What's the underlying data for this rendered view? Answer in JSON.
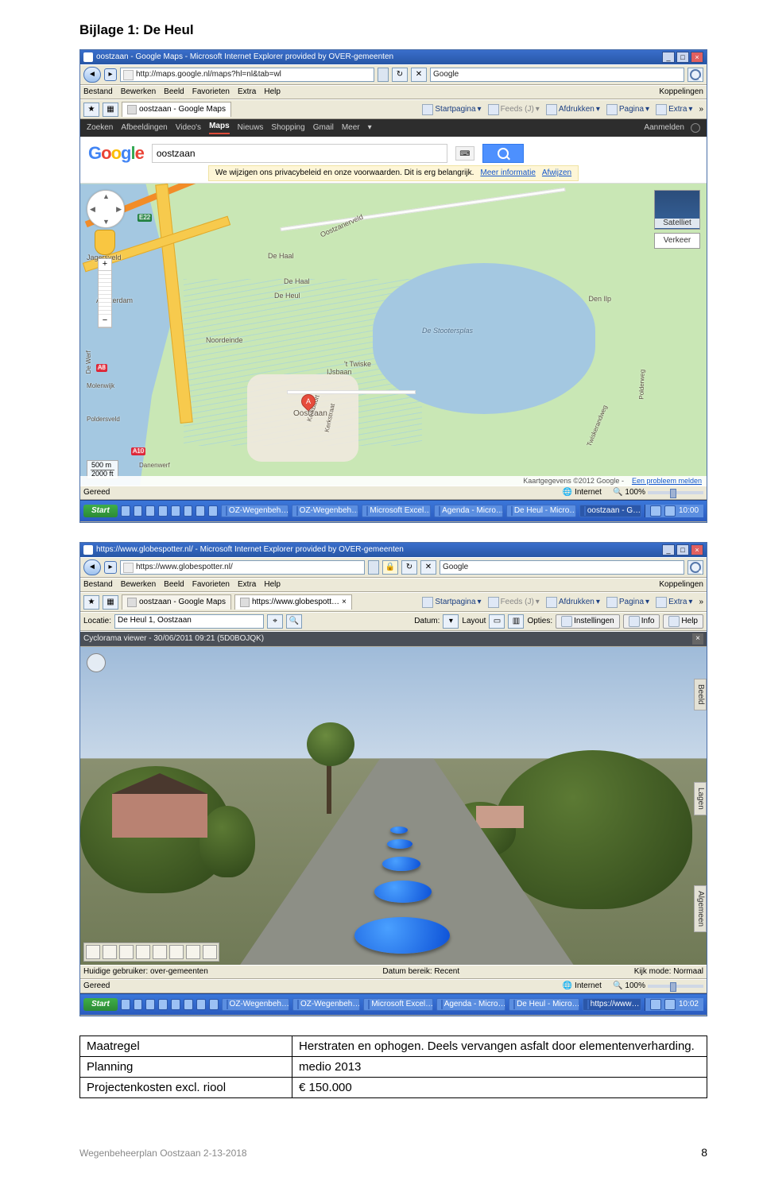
{
  "doc": {
    "title": "Bijlage 1: De Heul",
    "footer_left": "Wegenbeheerplan Oostzaan 2-13-2018",
    "page_number": "8"
  },
  "ie1": {
    "title": "oostzaan - Google Maps - Microsoft Internet Explorer provided by OVER-gemeenten",
    "url": "http://maps.google.nl/maps?hl=nl&tab=wl",
    "search_placeholder": "Google",
    "menus": [
      "Bestand",
      "Bewerken",
      "Beeld",
      "Favorieten",
      "Extra",
      "Help"
    ],
    "menu_right": "Koppelingen",
    "tab": "oostzaan - Google Maps",
    "toolbar_items": [
      "Startpagina",
      "Feeds (J)",
      "Afdrukken",
      "Pagina",
      "Extra"
    ],
    "toolbar_rss": "Feeds (J)",
    "status_left": "Gereed",
    "status_zone": "Internet",
    "status_zoom": "100%"
  },
  "gmaps": {
    "nav": [
      "Zoeken",
      "Afbeeldingen",
      "Video's",
      "Maps",
      "Nieuws",
      "Shopping",
      "Gmail",
      "Meer"
    ],
    "nav_active_index": 3,
    "signin": "Aanmelden",
    "logo_letters": [
      "G",
      "o",
      "o",
      "g",
      "l",
      "e"
    ],
    "search_value": "oostzaan",
    "privacy_text": "We wijzigen ons privacybeleid en onze voorwaarden. Dit is erg belangrijk.",
    "privacy_more": "Meer informatie",
    "privacy_dismiss": "Afwijzen",
    "sat_label": "Satelliet",
    "traffic_label": "Verkeer",
    "scale_top": "500 m",
    "scale_bottom": "2000 ft",
    "footer_left": "Kaartgegevens ©2012 Google -",
    "footer_link": "Een probleem melden",
    "pin_letter": "A",
    "pin_label": "Oostzaan",
    "labels": {
      "oostzanerveld": "Oostzanerveld",
      "dehaal": "De Haal",
      "deheul": "De Heul",
      "stootersplas": "De Stootersplas",
      "noordeinde": "Noordeinde",
      "twiske": "'t Twiske",
      "ijsbaan": "IJsbaan",
      "jagersveld": "Jagersveld",
      "amsterdam": "Amsterdam",
      "a8": "A8",
      "a10": "A10",
      "e22": "E22",
      "molenwijk": "Molenwijk",
      "poldersveld": "Poldersveld",
      "dewerf": "De Werf",
      "danenwerf": "Danenwerf",
      "denilp": "Den Ilp",
      "kerkbuurt": "Kerkbuurt",
      "kerkstraat": "Kerkstraat",
      "twiskerandweg": "Twiskerandweg",
      "polderweg": "Polderweg"
    }
  },
  "taskbar1": {
    "start": "Start",
    "buttons": [
      "OZ-Wegenbeh…",
      "OZ-Wegenbeh…",
      "Microsoft Excel…",
      "Agenda - Micro…",
      "De Heul - Micro…",
      "oostzaan - G…"
    ],
    "active_index": 5,
    "clock": "10:00"
  },
  "ie2": {
    "title": "https://www.globespotter.nl/ - Microsoft Internet Explorer provided by OVER-gemeenten",
    "url": "https://www.globespotter.nl/",
    "search_placeholder": "Google",
    "menus": [
      "Bestand",
      "Bewerken",
      "Beeld",
      "Favorieten",
      "Extra",
      "Help"
    ],
    "menu_right": "Koppelingen",
    "tabs": [
      "oostzaan - Google Maps",
      "https://www.globespott…"
    ],
    "tab_active_index": 1,
    "toolbar_items": [
      "Startpagina",
      "Feeds (J)",
      "Afdrukken",
      "Pagina",
      "Extra"
    ],
    "status_left": "Gereed",
    "status_zone": "Internet",
    "status_zoom": "100%"
  },
  "gs": {
    "loc_label": "Locatie:",
    "loc_value": "De Heul 1, Oostzaan",
    "date_label": "Datum:",
    "layout_label": "Layout",
    "options_label": "Opties:",
    "btn_instell": "Instellingen",
    "btn_info": "Info",
    "btn_help": "Help",
    "cyclo_title": "Cyclorama viewer - 30/06/2011 09:21 (5D0BOJQK)",
    "side_tabs": [
      "Beeld",
      "Lagen",
      "Algemeen"
    ],
    "footer_user_label": "Huidige gebruiker:",
    "footer_user_value": "over-gemeenten",
    "footer_date_label": "Datum bereik:",
    "footer_date_value": "Recent",
    "footer_mode_label": "Kijk mode:",
    "footer_mode_value": "Normaal"
  },
  "taskbar2": {
    "start": "Start",
    "buttons": [
      "OZ-Wegenbeh…",
      "OZ-Wegenbeh…",
      "Microsoft Excel…",
      "Agenda - Micro…",
      "De Heul - Micro…",
      "https://www…"
    ],
    "active_index": 5,
    "clock": "10:02"
  },
  "table": {
    "rows": [
      [
        "Maatregel",
        "Herstraten en ophogen. Deels vervangen asfalt door elementenverharding."
      ],
      [
        "Planning",
        "medio 2013"
      ],
      [
        "Projectenkosten excl. riool",
        "€ 150.000"
      ]
    ]
  }
}
